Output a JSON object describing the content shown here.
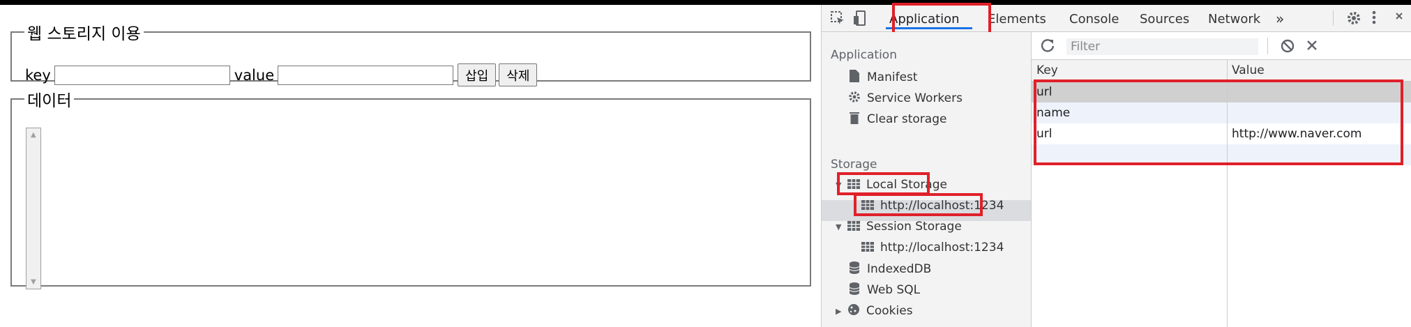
{
  "page": {
    "webstorage_legend": "웹 스토리지 이용",
    "key_label": "key",
    "value_label": "value",
    "key_value": "",
    "value_value": "",
    "insert_button": "삽입",
    "delete_button": "삭제",
    "data_legend": "데이터"
  },
  "devtools": {
    "tabs": [
      "Application",
      "Elements",
      "Console",
      "Sources",
      "Network"
    ],
    "more_tabs": "»",
    "sidebar": {
      "application_section": "Application",
      "application_items": [
        "Manifest",
        "Service Workers",
        "Clear storage"
      ],
      "storage_section": "Storage",
      "local_storage": "Local Storage",
      "local_storage_origin": "http://localhost:1234",
      "session_storage": "Session Storage",
      "session_storage_origin": "http://localhost:1234",
      "indexeddb": "IndexedDB",
      "websql": "Web SQL",
      "cookies": "Cookies"
    },
    "toolbar": {
      "filter_placeholder": "Filter"
    },
    "table": {
      "headers": [
        "Key",
        "Value"
      ],
      "rows": [
        {
          "key": "url",
          "value": ""
        },
        {
          "key": "name",
          "value": ""
        },
        {
          "key": "url",
          "value": "http://www.naver.com"
        },
        {
          "key": "",
          "value": ""
        }
      ]
    }
  },
  "colors": {
    "highlight": "#e0202a",
    "selection": "#dadce0",
    "active_tab_underline": "#1a73e8"
  }
}
